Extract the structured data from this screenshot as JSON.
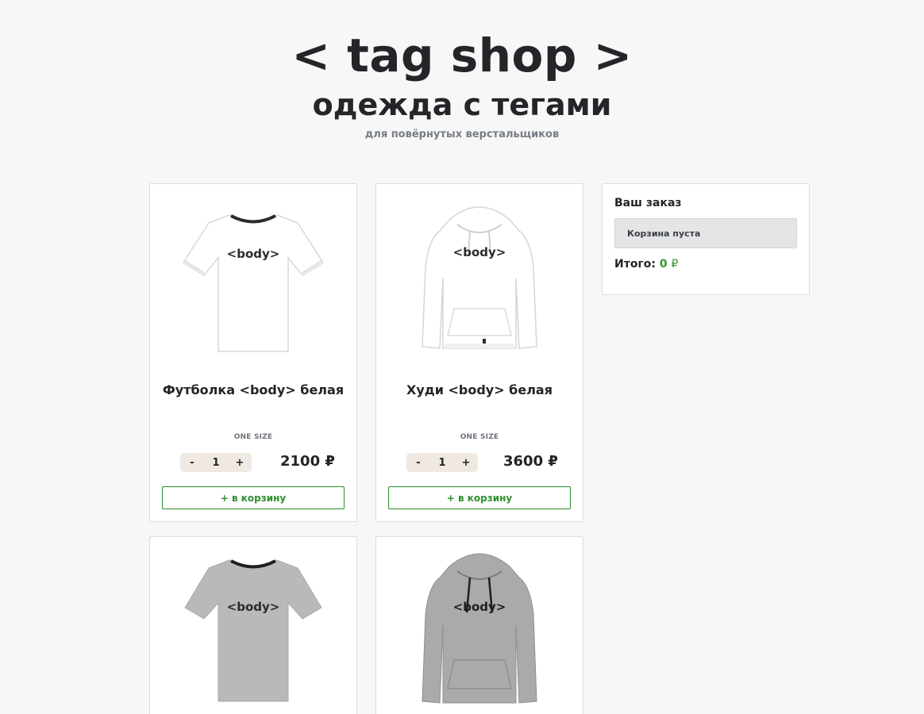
{
  "header": {
    "brand": "< tag shop >",
    "subtitle": "одежда с тегами",
    "tagline": "для повёрнутых верстальщиков"
  },
  "products": [
    {
      "name": "Футболка <body> белая",
      "size": "ONE SIZE",
      "qty": "1",
      "minus": "-",
      "plus": "+",
      "price": "2100 ₽",
      "add_label": "+ в корзину",
      "print_text": "<body>",
      "kind": "tshirt",
      "color": "#ffffff"
    },
    {
      "name": "Худи <body> белая",
      "size": "ONE SIZE",
      "qty": "1",
      "minus": "-",
      "plus": "+",
      "price": "3600 ₽",
      "add_label": "+ в корзину",
      "print_text": "<body>",
      "kind": "hoodie",
      "color": "#ffffff"
    },
    {
      "print_text": "<body>",
      "kind": "tshirt",
      "color": "#b8b9bb"
    },
    {
      "print_text": "<body>",
      "kind": "hoodie",
      "color": "#a9aaac"
    }
  ],
  "order": {
    "title": "Ваш заказ",
    "empty_text": "Корзина пуста",
    "total_label": "Итого:",
    "total_value": "0",
    "currency": "₽"
  },
  "colors": {
    "accent_green": "#2f8f2f",
    "background": "#f6f7f6",
    "stepper_bg": "#efe9e2"
  }
}
